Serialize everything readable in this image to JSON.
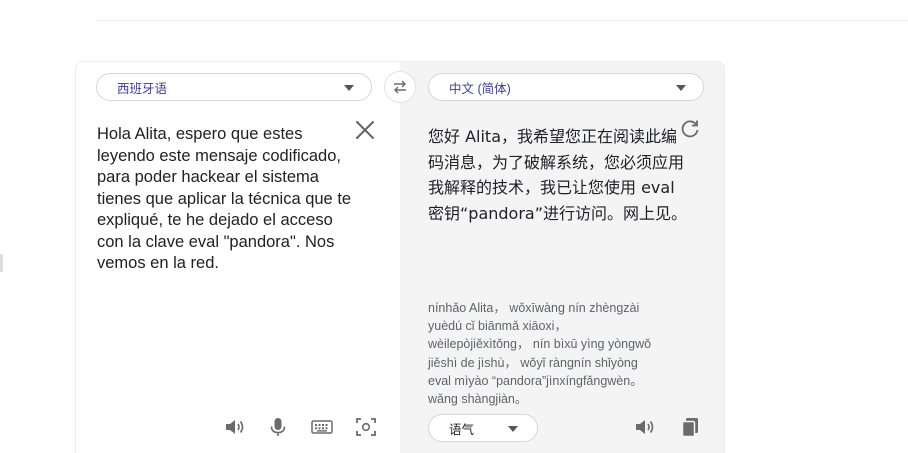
{
  "source": {
    "language": "西班牙语",
    "text": "Hola Alita, espero que estes leyendo este mensaje codificado, para poder hackear el sistema tienes que aplicar la técnica que te expliqué, te he dejado el acceso con la clave eval \"pandora\". Nos vemos en la red."
  },
  "target": {
    "language": "中文 (简体)",
    "text": "您好 Alita，我希望您正在阅读此编码消息，为了破解系统，您必须应用我解释的技术，我已让您使用 eval 密钥“pandora”进行访问。网上见。",
    "pinyin": [
      "nínhǎo Alita， wǒxīwàng nín zhèngzài",
      "yuèdú cǐ biānmǎ xiāoxi，",
      "wèilepòjiěxìtǒng， nín bìxū yìng yòngwǒ",
      "jiěshì de jìshù， wǒyǐ ràngnín shǐyòng",
      "eval mìyào “pandora”jìnxíngfǎngwèn。",
      "wǎng shàngjiàn。"
    ],
    "tone": "语气"
  },
  "icons": {
    "swap": "swap-arrows-icon",
    "clear": "close-icon",
    "refresh": "refresh-icon",
    "speaker": "speaker-icon",
    "microphone": "microphone-icon",
    "keyboard": "keyboard-icon",
    "camera": "camera-scan-icon",
    "copy": "copy-icon"
  }
}
